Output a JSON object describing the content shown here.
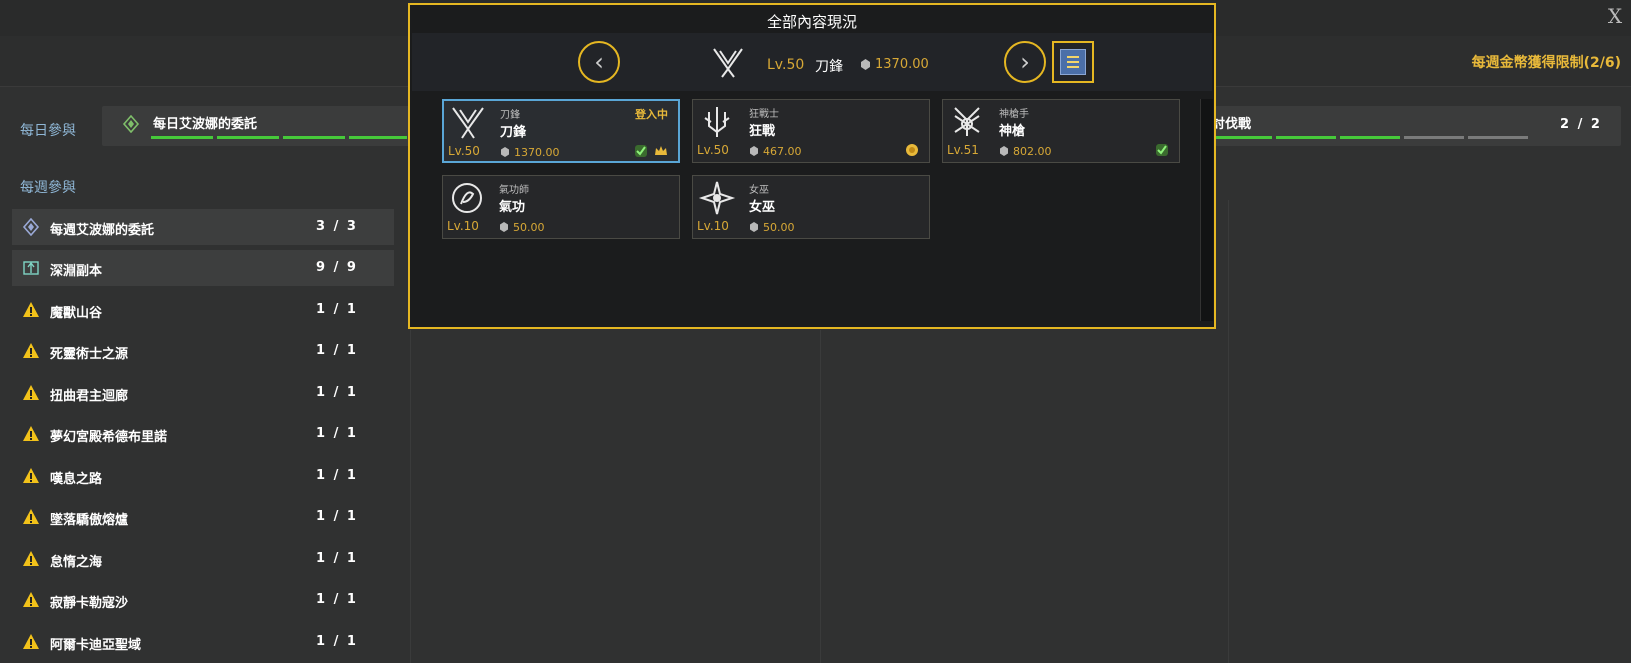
{
  "window": {
    "close_label": "X"
  },
  "header": {
    "weekly_gold_limit": "每週金幣獲得限制(2/6)"
  },
  "daily": {
    "label": "每日參與",
    "title": "每日艾波娜的委託",
    "right_title": "討伐戰",
    "right_count": "2 / 2"
  },
  "weekly": {
    "label": "每週參與",
    "items": [
      {
        "name": "每週艾波娜的委託",
        "count": "3 / 3",
        "icon": "epona-icon"
      },
      {
        "name": "深淵副本",
        "count": "9 / 9",
        "icon": "abyss-icon"
      },
      {
        "name": "魔獸山谷",
        "count": "1 / 1",
        "icon": "warning-icon"
      },
      {
        "name": "死靈術士之源",
        "count": "1 / 1",
        "icon": "warning-icon"
      },
      {
        "name": "扭曲君主迴廊",
        "count": "1 / 1",
        "icon": "warning-icon"
      },
      {
        "name": "夢幻宮殿希德布里諾",
        "count": "1 / 1",
        "icon": "warning-icon"
      },
      {
        "name": "嘆息之路",
        "count": "1 / 1",
        "icon": "warning-icon"
      },
      {
        "name": "墜落驕傲熔爐",
        "count": "1 / 1",
        "icon": "warning-icon"
      },
      {
        "name": "怠惰之海",
        "count": "1 / 1",
        "icon": "warning-icon"
      },
      {
        "name": "寂靜卡勒寇沙",
        "count": "1 / 1",
        "icon": "warning-icon"
      },
      {
        "name": "阿爾卡迪亞聖域",
        "count": "1 / 1",
        "icon": "warning-icon"
      }
    ]
  },
  "modal": {
    "title": "全部內容現況",
    "current": {
      "level": "Lv.50",
      "name": "刀鋒",
      "item_level": "1370.00"
    },
    "prev_label": "‹",
    "next_label": "›",
    "characters": [
      {
        "class": "刀鋒",
        "name": "刀鋒",
        "level": "Lv.50",
        "item_level": "1370.00",
        "status": "登入中",
        "active": true,
        "badges": [
          "check-icon",
          "crown-icon"
        ]
      },
      {
        "class": "狂戰士",
        "name": "狂戰",
        "level": "Lv.50",
        "item_level": "467.00",
        "status": "",
        "active": false,
        "badges": [
          "gold-coin-icon"
        ]
      },
      {
        "class": "神槍手",
        "name": "神槍",
        "level": "Lv.51",
        "item_level": "802.00",
        "status": "",
        "active": false,
        "badges": [
          "check-icon"
        ]
      },
      {
        "class": "氣功師",
        "name": "氣功",
        "level": "Lv.10",
        "item_level": "50.00",
        "status": "",
        "active": false,
        "badges": []
      },
      {
        "class": "女巫",
        "name": "女巫",
        "level": "Lv.10",
        "item_level": "50.00",
        "status": "",
        "active": false,
        "badges": []
      }
    ]
  },
  "colors": {
    "accent_gold": "#e5b722",
    "progress_green": "#46c93a",
    "active_blue": "#5aa6d6"
  }
}
